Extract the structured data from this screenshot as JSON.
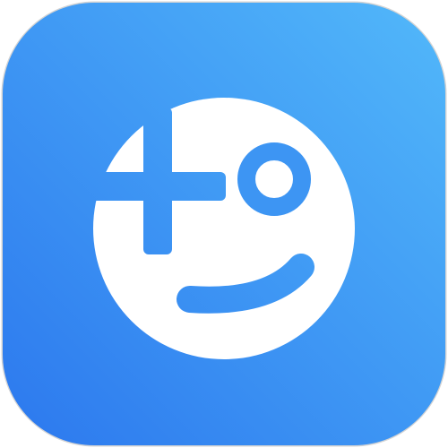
{
  "app_icon": {
    "icon_name": "smiley-face-plus-app-icon",
    "colors": {
      "gradient_start": "#2C78EE",
      "gradient_end": "#52B8FA",
      "face": "#FFFFFF",
      "frame": "#D4D4D4"
    }
  }
}
